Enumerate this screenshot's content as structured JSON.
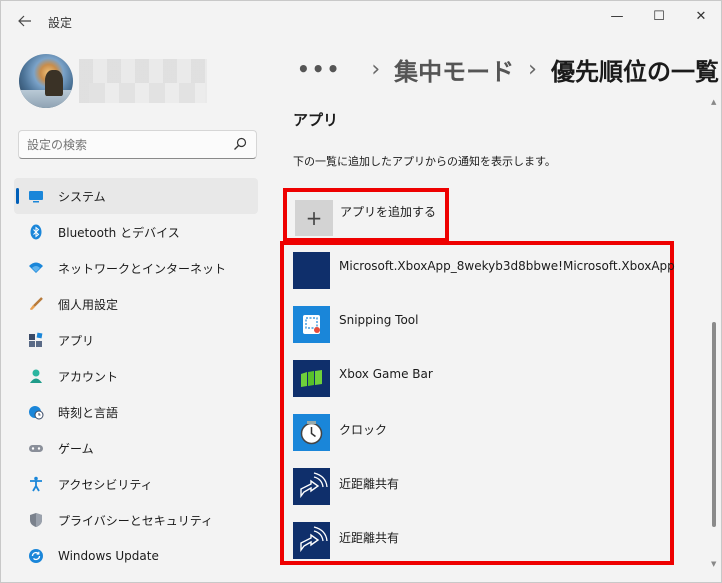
{
  "window": {
    "title": "設定",
    "back_icon": "back-arrow-icon",
    "minimize": "—",
    "maximize": "☐",
    "close": "✕"
  },
  "search": {
    "placeholder": "設定の検索",
    "icon": "search-icon"
  },
  "sidebar": {
    "items": [
      {
        "label": "システム",
        "icon": "system-display-icon",
        "active": true
      },
      {
        "label": "Bluetooth とデバイス",
        "icon": "bluetooth-icon"
      },
      {
        "label": "ネットワークとインターネット",
        "icon": "wifi-icon"
      },
      {
        "label": "個人用設定",
        "icon": "brush-icon"
      },
      {
        "label": "アプリ",
        "icon": "apps-icon"
      },
      {
        "label": "アカウント",
        "icon": "account-icon"
      },
      {
        "label": "時刻と言語",
        "icon": "globe-clock-icon"
      },
      {
        "label": "ゲーム",
        "icon": "gamepad-icon"
      },
      {
        "label": "アクセシビリティ",
        "icon": "accessibility-icon"
      },
      {
        "label": "プライバシーとセキュリティ",
        "icon": "shield-icon"
      },
      {
        "label": "Windows Update",
        "icon": "update-icon"
      }
    ]
  },
  "breadcrumb": {
    "dots": "•••",
    "sep": "›",
    "parent": "集中モード",
    "current": "優先順位の一覧"
  },
  "section": {
    "title": "アプリ",
    "description": "下の一覧に追加したアプリからの通知を表示します。"
  },
  "add_app": {
    "button_glyph": "+",
    "label": "アプリを追加する"
  },
  "apps": [
    {
      "name": "Microsoft.XboxApp_8wekyb3d8bbwe!Microsoft.XboxApp",
      "icon": "xbox-app-icon"
    },
    {
      "name": "Snipping Tool",
      "icon": "snipping-tool-icon"
    },
    {
      "name": "Xbox Game Bar",
      "icon": "xbox-game-bar-icon"
    },
    {
      "name": "クロック",
      "icon": "clock-icon"
    },
    {
      "name": "近距離共有",
      "icon": "nearby-share-icon"
    },
    {
      "name": "近距離共有",
      "icon": "nearby-share-icon"
    }
  ],
  "colors": {
    "accent": "#005fb8",
    "highlight_border": "#ee0000",
    "app_tile_blue": "#0f2f6b"
  }
}
